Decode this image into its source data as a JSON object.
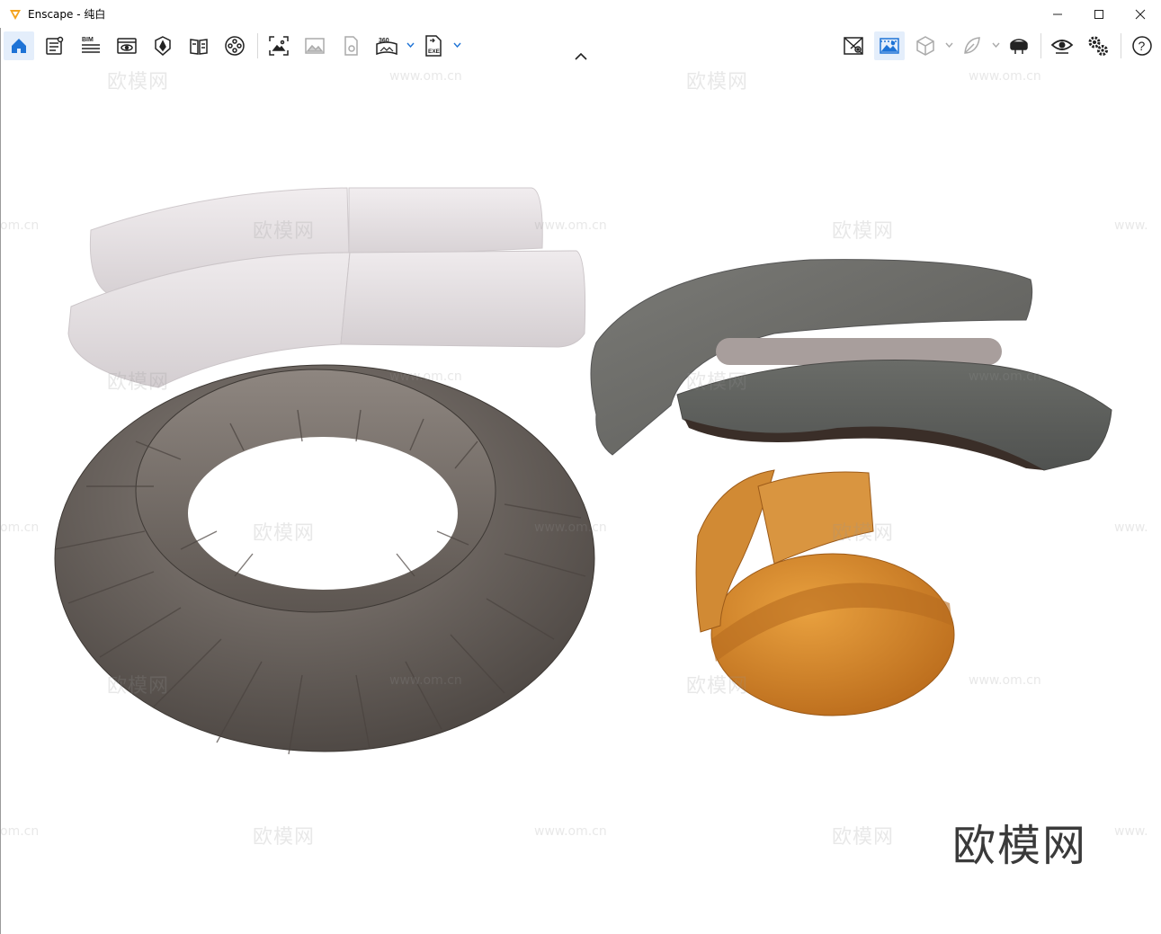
{
  "window": {
    "title": "Enscape - 纯白",
    "accent": "#f4a31d"
  },
  "window_controls": {
    "minimize": "minimize-icon",
    "maximize": "maximize-icon",
    "close": "close-icon"
  },
  "toolbar": {
    "left_buttons": [
      {
        "name": "home-icon",
        "active": true
      },
      {
        "name": "asset-library-icon"
      },
      {
        "name": "bim-icon",
        "label": "BIM"
      },
      {
        "name": "view-icon"
      },
      {
        "name": "atmosphere-icon"
      },
      {
        "name": "material-book-icon"
      },
      {
        "name": "video-editor-icon"
      },
      {
        "name": "screenshot-icon"
      },
      {
        "name": "image-icon"
      },
      {
        "name": "render-panorama-icon"
      },
      {
        "name": "panorama-360-icon",
        "label": "360"
      },
      {
        "name": "export-exe-icon",
        "label": "EXE"
      }
    ],
    "right_buttons": [
      {
        "name": "map-icon"
      },
      {
        "name": "white-mode-icon",
        "active": true
      },
      {
        "name": "cube-icon"
      },
      {
        "name": "feather-icon"
      },
      {
        "name": "vr-headset-icon"
      },
      {
        "name": "visibility-icon"
      },
      {
        "name": "settings-icon"
      },
      {
        "name": "help-icon"
      }
    ]
  },
  "watermark": {
    "logo_text": "欧模网",
    "url_text": "www.om.cn",
    "url_partial": "om.cn",
    "url_partial_right": "www."
  },
  "scene": {
    "colors": {
      "white_sofa": "#e8e3e5",
      "grey_sofa": "#6e6e6a",
      "ring_sofa": "#5f5853",
      "orange_chair": "#d98a2c"
    }
  }
}
